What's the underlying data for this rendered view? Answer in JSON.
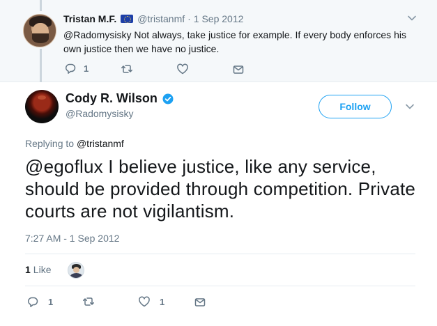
{
  "parent_tweet": {
    "name": "Tristan M.F.",
    "flag_icon": "eu-flag-icon",
    "handle": "@tristanmf",
    "separator": "·",
    "date": "1 Sep 2012",
    "text": "@Radomysisky Not always, take justice for example. If every body enforces his own justice then we have no justice.",
    "reply_count": "1",
    "retweet_count": "",
    "like_count": ""
  },
  "main_tweet": {
    "name": "Cody R. Wilson",
    "handle": "@Radomysisky",
    "follow_label": "Follow",
    "replying_prefix": "Replying to",
    "replying_to": "@tristanmf",
    "mention": "@egoflux",
    "text": " I believe justice, like any service, should be provided through competition. Private courts are not vigilantism.",
    "timestamp": "7:27 AM - 1 Sep 2012",
    "likes_count": "1",
    "likes_label": "Like",
    "reply_count": "1",
    "retweet_count": "",
    "like_count": "1"
  },
  "colors": {
    "accent": "#1da1f2",
    "secondary_text": "#657786",
    "primary_text": "#14171a",
    "parent_background": "#f5f8fa",
    "divider": "#e6ecf0"
  }
}
